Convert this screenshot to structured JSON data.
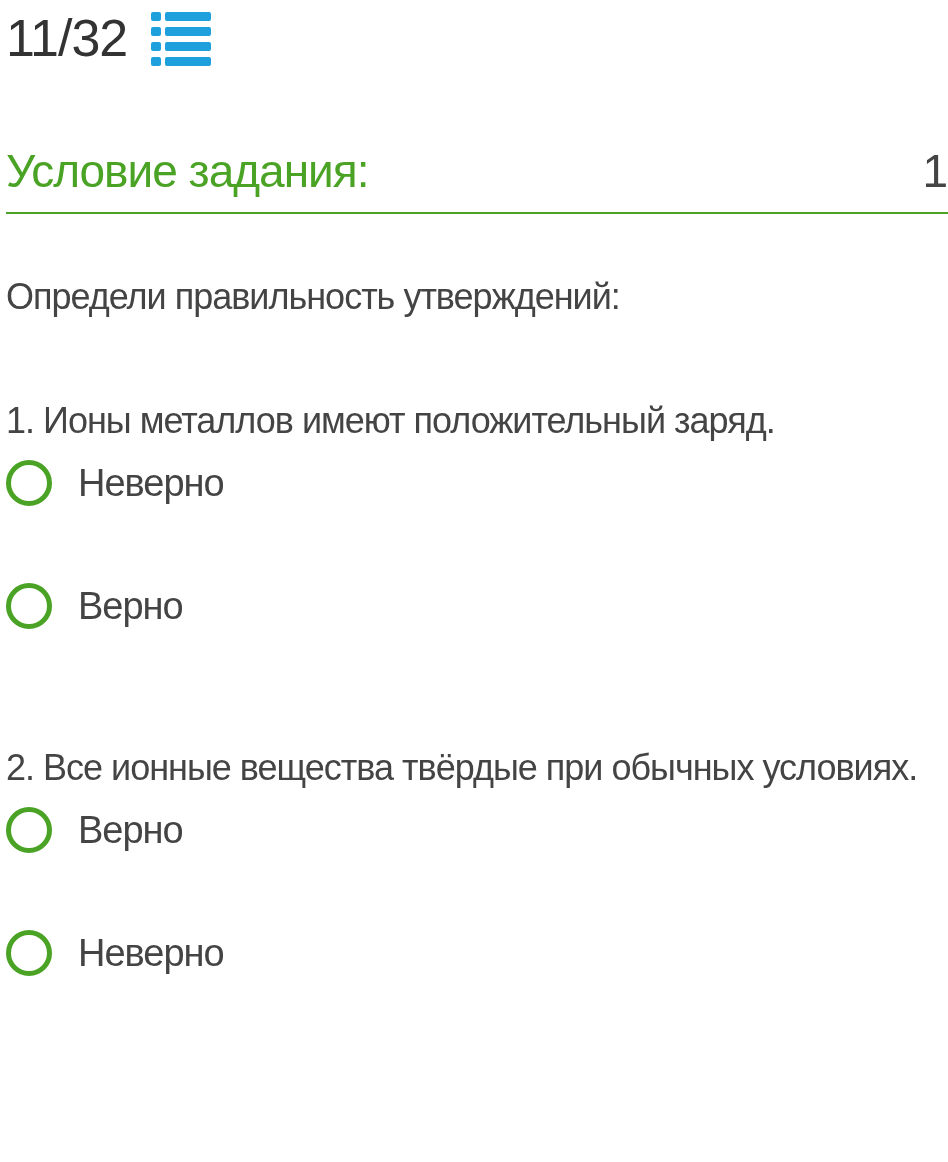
{
  "counter": "11/32",
  "condition": {
    "title": "Условие задания:",
    "points": "1"
  },
  "prompt": "Определи правильность утверждений:",
  "questions": [
    {
      "text": "1. Ионы металлов имеют положительный заряд.",
      "options": [
        {
          "label": "Неверно",
          "selected": false
        },
        {
          "label": "Верно",
          "selected": false
        }
      ]
    },
    {
      "text": "2. Все ионные вещества твёрдые при обычных условиях.",
      "options": [
        {
          "label": "Верно",
          "selected": false
        },
        {
          "label": "Неверно",
          "selected": false
        }
      ]
    }
  ]
}
